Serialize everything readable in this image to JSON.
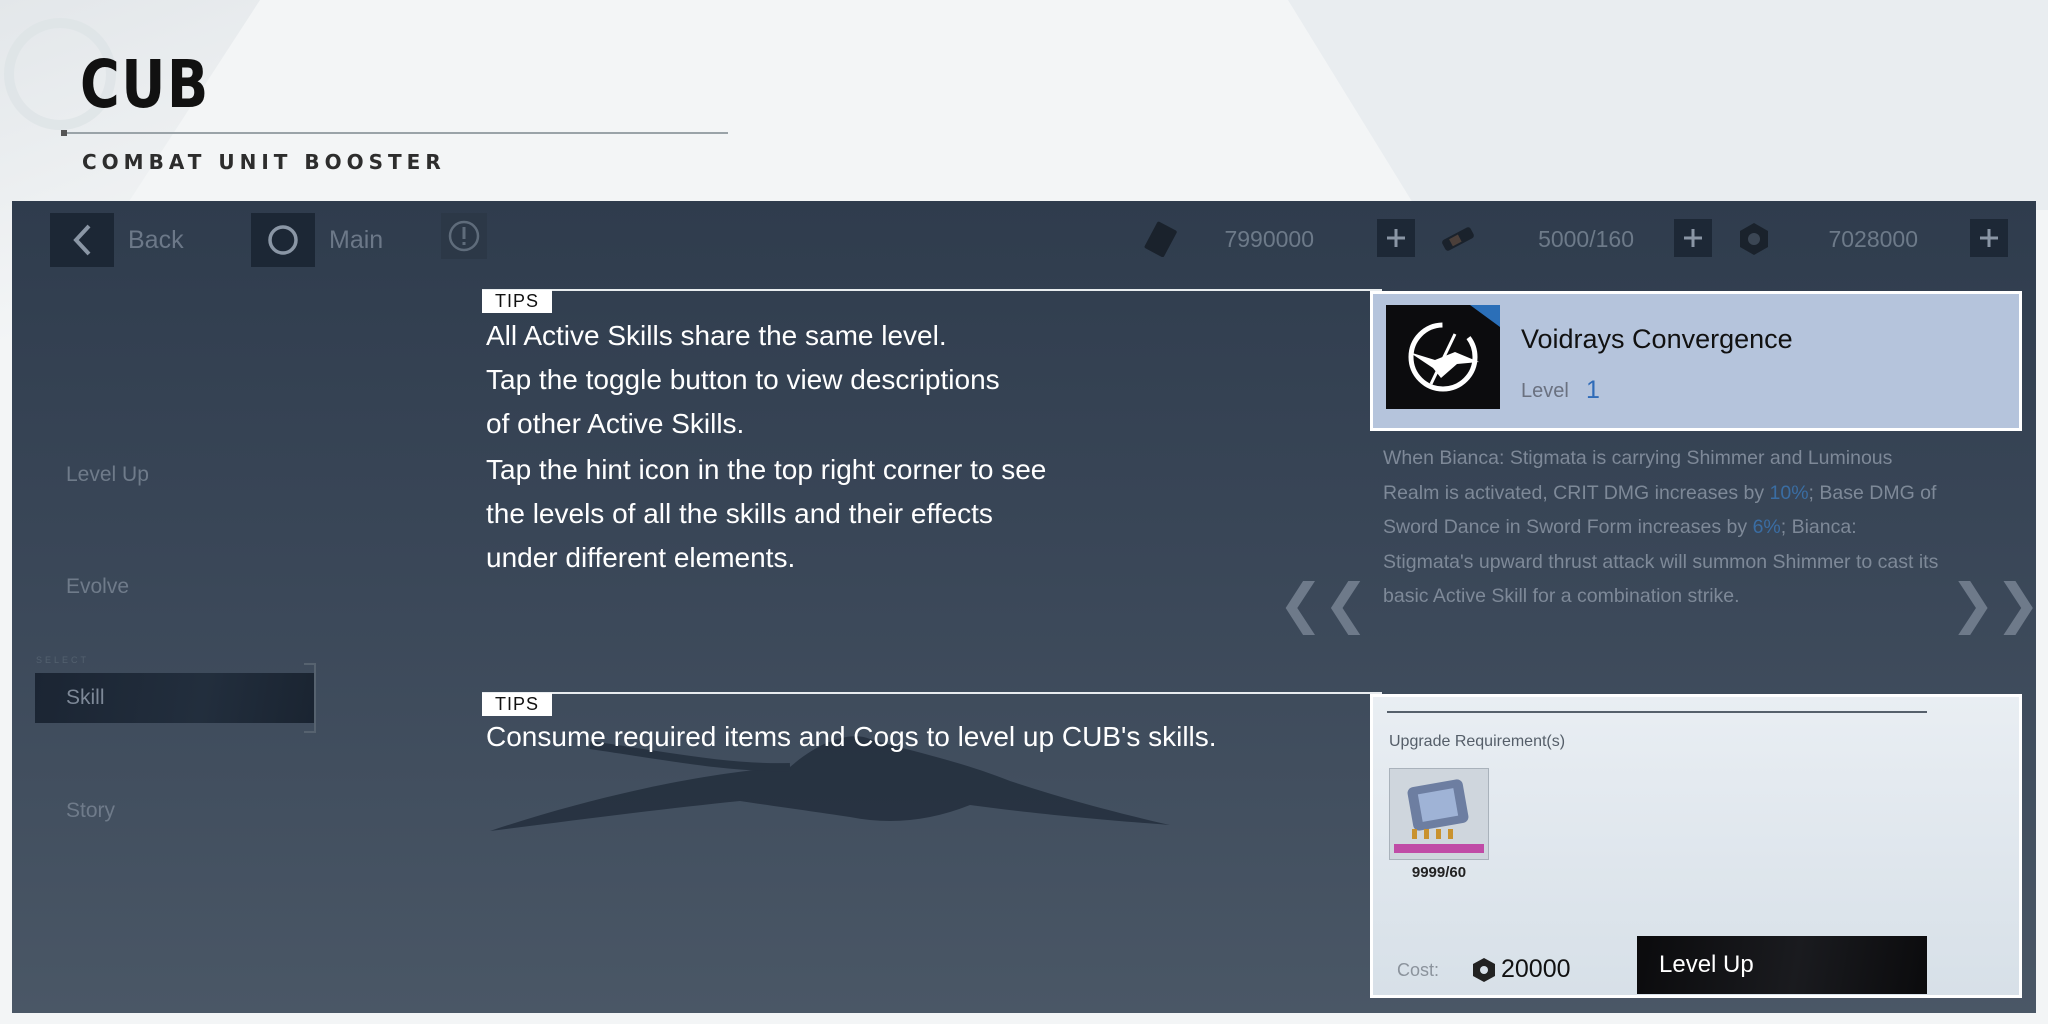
{
  "header": {
    "title": "CUB",
    "subtitle": "COMBAT UNIT BOOSTER"
  },
  "topbar": {
    "back_label": "Back",
    "main_label": "Main",
    "resources": [
      {
        "icon": "card-icon",
        "value": "7990000"
      },
      {
        "icon": "material-icon",
        "value": "5000/160"
      },
      {
        "icon": "cog-currency-icon",
        "value": "7028000"
      }
    ]
  },
  "sidebar": {
    "select_tag": "SELECT",
    "items": [
      {
        "label": "Level Up"
      },
      {
        "label": "Evolve"
      },
      {
        "label": "Skill"
      },
      {
        "label": "Story"
      }
    ],
    "active_index": 2
  },
  "tips": [
    {
      "badge": "TIPS",
      "lines": [
        "All Active Skills share the same level.",
        "Tap the toggle button to view descriptions",
        "of other Active Skills."
      ],
      "lines2": [
        "Tap the hint icon in the top right corner to see",
        "the levels of all the skills and their effects",
        "under different elements."
      ]
    },
    {
      "badge": "TIPS",
      "lines": [
        "Consume required items and Cogs to level up CUB's skills."
      ]
    }
  ],
  "skill": {
    "name": "Voidrays Convergence",
    "level_label": "Level",
    "level_value": "1",
    "description_parts": [
      "When Bianca: Stigmata is carrying Shimmer and Luminous Realm is activated, CRIT DMG increases by ",
      "10%",
      "; Base DMG of Sword Dance in Sword Form increases by ",
      "6%",
      "; Bianca: Stigmata's upward thrust attack will summon Shimmer to cast its basic Active Skill for a combination strike."
    ],
    "prev_arrow": "❮❮",
    "next_arrow": "❯❯"
  },
  "requirements": {
    "title": "Upgrade Requirement(s)",
    "items": [
      {
        "name": "chip-item",
        "count": "9999/60"
      }
    ],
    "cost_label": "Cost:",
    "cost_value": "20000",
    "level_up_label": "Level Up"
  },
  "colors": {
    "panel": "#34414f",
    "skill_card": "#b5c4dc",
    "level_accent": "#2f6bb8",
    "highlight": "#3a6da3"
  }
}
